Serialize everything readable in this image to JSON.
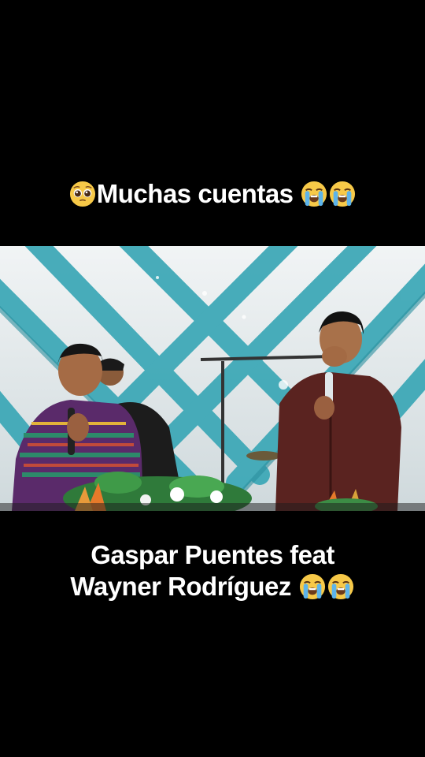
{
  "top_caption": {
    "text": "Muchas cuentas",
    "lead_emoji": "pleading-face-emoji",
    "trail_emojis": [
      "loudly-crying-face-emoji",
      "loudly-crying-face-emoji"
    ]
  },
  "bottom_caption": {
    "line1": "Gaspar Puentes feat",
    "line2": "Wayner Rodríguez",
    "trail_emojis": [
      "loudly-crying-face-emoji",
      "loudly-crying-face-emoji"
    ]
  },
  "video": {
    "scene": "two-singers-on-stage",
    "colors": {
      "drape": "#3aa7b6",
      "background": "#e9eef0",
      "floor": "#1c1c1c"
    }
  }
}
